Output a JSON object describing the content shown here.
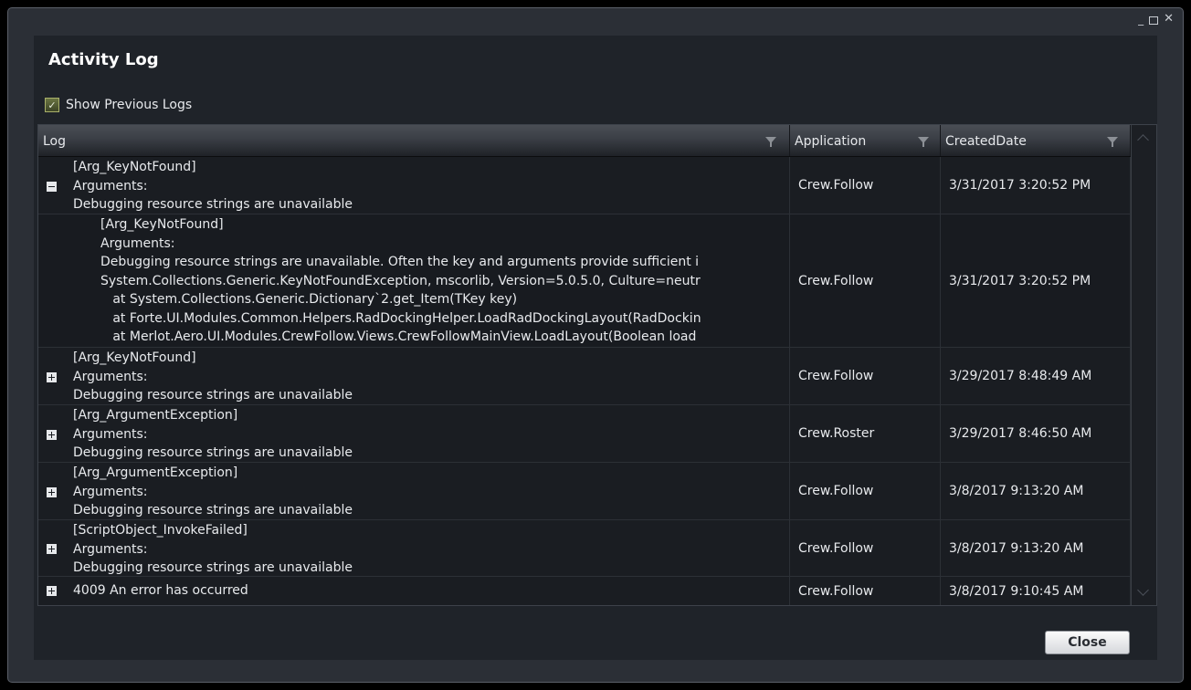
{
  "window": {
    "minimize_glyph": "_",
    "close_glyph": "✕"
  },
  "title": "Activity Log",
  "show_previous": {
    "label": "Show Previous Logs",
    "checked": true
  },
  "columns": {
    "log": "Log",
    "application": "Application",
    "created_date": "CreatedDate"
  },
  "rows": [
    {
      "expanded": true,
      "log": [
        "[Arg_KeyNotFound]",
        "Arguments:",
        "Debugging resource strings are unavailable"
      ],
      "application": "Crew.Follow",
      "created_date": "3/31/2017 3:20:52 PM"
    },
    {
      "detail": true,
      "log": [
        "[Arg_KeyNotFound]",
        "Arguments:",
        "Debugging resource strings are unavailable. Often the key and arguments provide sufficient i",
        "System.Collections.Generic.KeyNotFoundException, mscorlib, Version=5.0.5.0, Culture=neutr",
        "   at System.Collections.Generic.Dictionary`2.get_Item(TKey key)",
        "   at Forte.UI.Modules.Common.Helpers.RadDockingHelper.LoadRadDockingLayout(RadDockin",
        "   at Merlot.Aero.UI.Modules.CrewFollow.Views.CrewFollowMainView.LoadLayout(Boolean load"
      ],
      "application": "Crew.Follow",
      "created_date": "3/31/2017 3:20:52 PM"
    },
    {
      "log": [
        "[Arg_KeyNotFound]",
        "Arguments:",
        "Debugging resource strings are unavailable"
      ],
      "application": "Crew.Follow",
      "created_date": "3/29/2017 8:48:49 AM"
    },
    {
      "log": [
        "[Arg_ArgumentException]",
        "Arguments:",
        "Debugging resource strings are unavailable"
      ],
      "application": "Crew.Roster",
      "created_date": "3/29/2017 8:46:50 AM"
    },
    {
      "log": [
        "[Arg_ArgumentException]",
        "Arguments:",
        "Debugging resource strings are unavailable"
      ],
      "application": "Crew.Follow",
      "created_date": "3/8/2017 9:13:20 AM"
    },
    {
      "log": [
        "[ScriptObject_InvokeFailed]",
        "Arguments:",
        "Debugging resource strings are unavailable"
      ],
      "application": "Crew.Follow",
      "created_date": "3/8/2017 9:13:20 AM"
    },
    {
      "log": [
        "4009 An error has occurred"
      ],
      "application": "Crew.Follow",
      "created_date": "3/8/2017 9:10:45 AM"
    }
  ],
  "close_button": "Close"
}
